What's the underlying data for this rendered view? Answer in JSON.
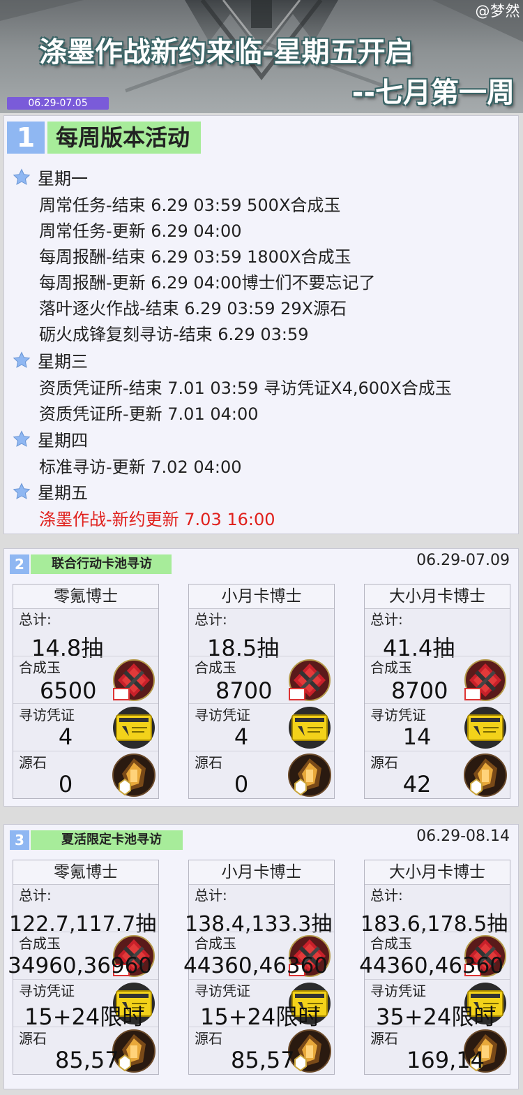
{
  "header": {
    "watermark": "@梦然",
    "title_line1": "涤墨作战新约来临-星期五开启",
    "title_line2": "--七月第一周",
    "date_range": "06.29-07.05"
  },
  "section1": {
    "num": "1",
    "title": "每周版本活动",
    "days": [
      {
        "label": "星期一",
        "events": [
          "周常任务-结束 6.29 03:59  500X合成玉",
          "周常任务-更新 6.29 04:00",
          "每周报酬-结束 6.29 03:59  1800X合成玉",
          "每周报酬-更新 6.29 04:00博士们不要忘记了",
          "落叶逐火作战-结束 6.29 03:59 29X源石",
          "砺火成锋复刻寻访-结束 6.29 03:59"
        ]
      },
      {
        "label": "星期三",
        "events": [
          "资质凭证所-结束 7.01 03:59  寻访凭证X4,600X合成玉",
          "资质凭证所-更新 7.01 04:00"
        ]
      },
      {
        "label": "星期四",
        "events": [
          "标准寻访-更新 7.02 04:00"
        ]
      },
      {
        "label": "星期五",
        "events": [
          "涤墨作战-新约更新 7.03 16:00"
        ]
      }
    ],
    "highlight_color": "#e0201c"
  },
  "section2": {
    "num": "2",
    "title": "联合行动卡池寻访",
    "date": "06.29-07.09",
    "row_labels": {
      "total": "总计:",
      "orundum": "合成玉",
      "permit": "寻访凭证",
      "originite": "源石"
    },
    "cards": [
      {
        "name": "零氪博士",
        "total": "14.8抽",
        "orundum": "6500",
        "permit": "4",
        "originite": "0"
      },
      {
        "name": "小月卡博士",
        "total": "18.5抽",
        "orundum": "8700",
        "permit": "4",
        "originite": "0"
      },
      {
        "name": "大小月卡博士",
        "total": "41.4抽",
        "orundum": "8700",
        "permit": "14",
        "originite": "42"
      }
    ]
  },
  "section3": {
    "num": "3",
    "title": "夏活限定卡池寻访",
    "date": "06.29-08.14",
    "row_labels": {
      "total": "总计:",
      "orundum": "合成玉",
      "permit": "寻访凭证",
      "originite": "源石"
    },
    "cards": [
      {
        "name": "零氪博士",
        "total": "122.7,117.7抽",
        "orundum": "34960,36960",
        "permit": "15+24限时",
        "originite": "85,57"
      },
      {
        "name": "小月卡博士",
        "total": "138.4,133.3抽",
        "orundum": "44360,46360",
        "permit": "15+24限时",
        "originite": "85,57"
      },
      {
        "name": "大小月卡博士",
        "total": "183.6,178.5抽",
        "orundum": "44360,46360",
        "permit": "35+24限时",
        "originite": "169,14"
      }
    ]
  },
  "icons": {
    "day": "star-icon",
    "orundum": "orundum-icon",
    "permit": "headhunting-permit-icon",
    "originite": "originite-prime-icon"
  },
  "colors": {
    "section_num": "#8fb7f2",
    "section_title": "#a7ec9a",
    "date_tag": "#7a5bd9"
  }
}
